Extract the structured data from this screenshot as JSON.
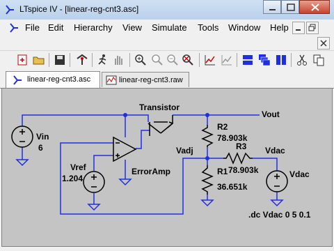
{
  "window": {
    "title": "LTspice IV - [linear-reg-cnt3.asc]"
  },
  "menu": [
    "File",
    "Edit",
    "Hierarchy",
    "View",
    "Simulate",
    "Tools",
    "Window",
    "Help"
  ],
  "tabs": [
    {
      "label": "linear-reg-cnt3.asc",
      "active": true
    },
    {
      "label": "linear-reg-cnt3.raw",
      "active": false
    }
  ],
  "schematic": {
    "labels": {
      "transistor": "Transistor",
      "vout": "Vout",
      "vin": "Vin",
      "vin_value": "6",
      "r2": "R2",
      "r2_value": "78.903k",
      "r3": "R3",
      "r3_value": "78.903k",
      "vadj": "Vadj",
      "vdac_net": "Vdac",
      "r1": "R1",
      "r1_value": "36.651k",
      "vdac_source": "Vdac",
      "vref": "Vref",
      "vref_value": "1.204",
      "erroramp": "ErrorAmp",
      "directive": ".dc Vdac 0 5 0.1"
    }
  },
  "colors": {
    "wire": "#1e2ee0",
    "component": "#000000",
    "ground": "#1e2ee0",
    "canvas": "#c4c4c4",
    "node": "#1e2ee0"
  }
}
